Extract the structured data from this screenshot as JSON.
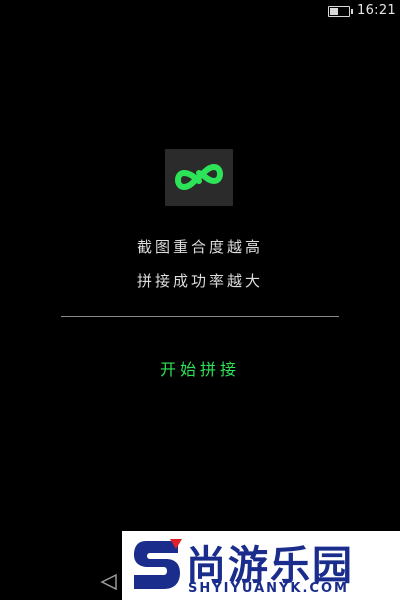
{
  "status_bar": {
    "time": "16:21",
    "battery_level": 0.45
  },
  "app": {
    "logo_icon": "infinity-icon",
    "accent_color": "#2de357"
  },
  "main": {
    "desc_line1": "截图重合度越高",
    "desc_line2": "拼接成功率越大",
    "start_button_label": "开始拼接"
  },
  "nav": {
    "back_icon": "back-triangle-icon"
  },
  "watermark": {
    "cn_text": "尚游乐园",
    "en_text": "SHYIYUANYK.COM"
  }
}
